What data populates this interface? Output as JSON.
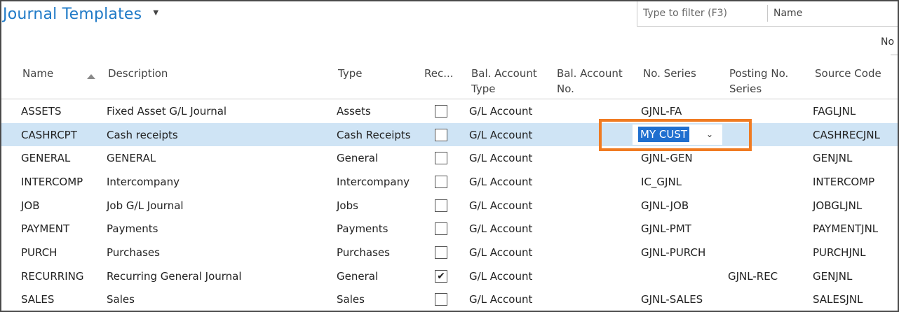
{
  "page": {
    "title": "Journal Templates",
    "filter_placeholder": "Type to filter (F3)",
    "filter_field": "Name",
    "no_label": "No"
  },
  "columns": {
    "name": "Name",
    "description": "Description",
    "type": "Type",
    "recurring": "Rec...",
    "bal_account_type": "Bal. Account\nType",
    "bal_account_no": "Bal. Account\nNo.",
    "no_series": "No. Series",
    "posting_no_series": "Posting No.\nSeries",
    "source_code": "Source Code"
  },
  "rows": [
    {
      "name": "ASSETS",
      "description": "Fixed Asset G/L Journal",
      "type": "Assets",
      "recurring": false,
      "bal_account_type": "G/L Account",
      "bal_account_no": "",
      "no_series": "GJNL-FA",
      "posting_no_series": "",
      "source_code": "FAGLJNL"
    },
    {
      "name": "CASHRCPT",
      "description": "Cash receipts",
      "type": "Cash Receipts",
      "recurring": false,
      "bal_account_type": "G/L Account",
      "bal_account_no": "",
      "no_series": "MY CUST",
      "posting_no_series": "",
      "source_code": "CASHRECJNL"
    },
    {
      "name": "GENERAL",
      "description": "GENERAL",
      "type": "General",
      "recurring": false,
      "bal_account_type": "G/L Account",
      "bal_account_no": "",
      "no_series": "GJNL-GEN",
      "posting_no_series": "",
      "source_code": "GENJNL"
    },
    {
      "name": "INTERCOMP",
      "description": "Intercompany",
      "type": "Intercompany",
      "recurring": false,
      "bal_account_type": "G/L Account",
      "bal_account_no": "",
      "no_series": "IC_GJNL",
      "posting_no_series": "",
      "source_code": "INTERCOMP"
    },
    {
      "name": "JOB",
      "description": "Job G/L Journal",
      "type": "Jobs",
      "recurring": false,
      "bal_account_type": "G/L Account",
      "bal_account_no": "",
      "no_series": "GJNL-JOB",
      "posting_no_series": "",
      "source_code": "JOBGLJNL"
    },
    {
      "name": "PAYMENT",
      "description": "Payments",
      "type": "Payments",
      "recurring": false,
      "bal_account_type": "G/L Account",
      "bal_account_no": "",
      "no_series": "GJNL-PMT",
      "posting_no_series": "",
      "source_code": "PAYMENTJNL"
    },
    {
      "name": "PURCH",
      "description": "Purchases",
      "type": "Purchases",
      "recurring": false,
      "bal_account_type": "G/L Account",
      "bal_account_no": "",
      "no_series": "GJNL-PURCH",
      "posting_no_series": "",
      "source_code": "PURCHJNL"
    },
    {
      "name": "RECURRING",
      "description": "Recurring General Journal",
      "type": "General",
      "recurring": true,
      "bal_account_type": "G/L Account",
      "bal_account_no": "",
      "no_series": "",
      "posting_no_series": "GJNL-REC",
      "source_code": "GENJNL"
    },
    {
      "name": "SALES",
      "description": "Sales",
      "type": "Sales",
      "recurring": false,
      "bal_account_type": "G/L Account",
      "bal_account_no": "",
      "no_series": "GJNL-SALES",
      "posting_no_series": "",
      "source_code": "SALESJNL"
    }
  ],
  "selected_row": "CASHRCPT",
  "icons": {
    "title_dropdown": "chevron-down-icon",
    "sort": "sort-ascending-icon",
    "series_dropdown": "chevron-down-icon",
    "checkbox_checked": "check-icon"
  },
  "colors": {
    "title": "#1f7ac7",
    "selected_row": "#cfe4f5",
    "edit_selection": "#1f6fcf",
    "highlight_box": "#f07b22"
  }
}
